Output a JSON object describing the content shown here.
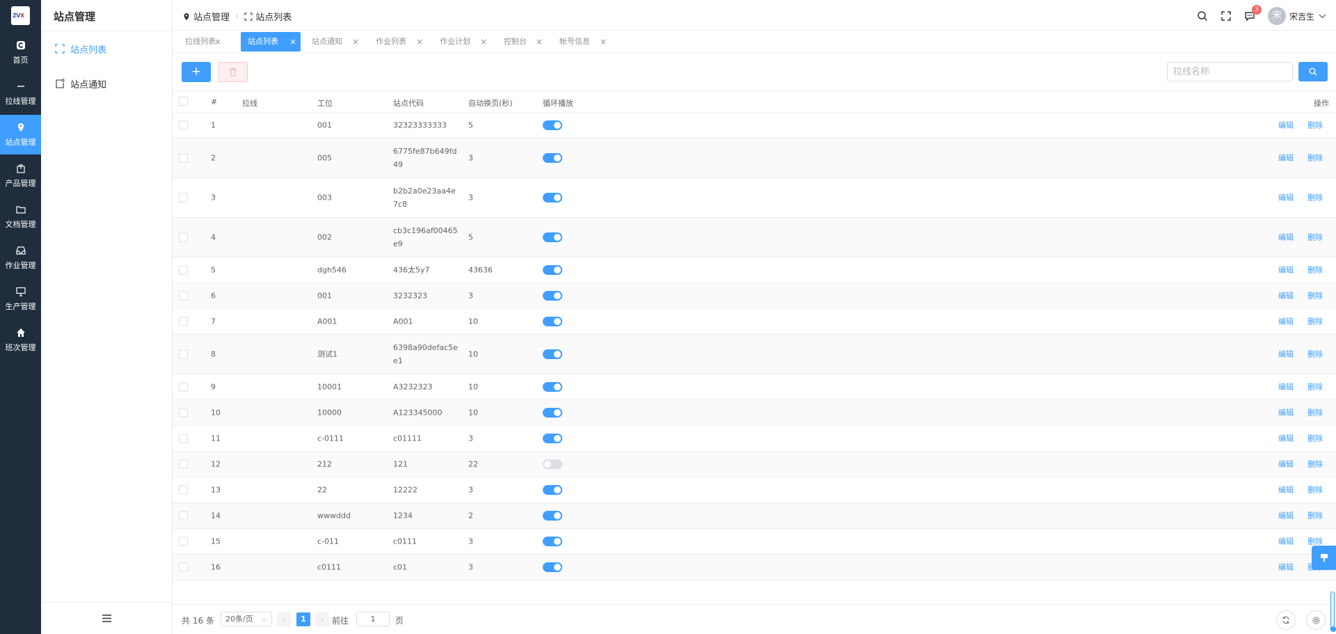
{
  "logo": {
    "text_a": "ZV",
    "text_b": "X"
  },
  "rail": {
    "items": [
      {
        "label": "首页",
        "icon": "home-c-icon"
      },
      {
        "label": "拉线管理",
        "icon": "minus-icon"
      },
      {
        "label": "站点管理",
        "icon": "location-icon"
      },
      {
        "label": "产品管理",
        "icon": "box-icon"
      },
      {
        "label": "文档管理",
        "icon": "folder-icon"
      },
      {
        "label": "作业管理",
        "icon": "inbox-icon"
      },
      {
        "label": "生产管理",
        "icon": "monitor-icon"
      },
      {
        "label": "班次管理",
        "icon": "house-icon"
      }
    ],
    "active_index": 2
  },
  "subside": {
    "title": "站点管理",
    "items": [
      {
        "label": "站点列表",
        "icon": "fullscreen-icon"
      },
      {
        "label": "站点通知",
        "icon": "notice-icon"
      }
    ],
    "active_index": 0
  },
  "header": {
    "breadcrumb": [
      "站点管理",
      "站点列表"
    ],
    "message_count": "3",
    "user_name": "宋吉生",
    "avatar_text": "宋"
  },
  "tabs": [
    {
      "label": "拉线列表"
    },
    {
      "label": "站点列表"
    },
    {
      "label": "站点通知"
    },
    {
      "label": "作业列表"
    },
    {
      "label": "作业计划"
    },
    {
      "label": "控制台"
    },
    {
      "label": "帐号信息"
    }
  ],
  "active_tab": 1,
  "toolbar": {
    "add_symbol": "+",
    "search_placeholder": "拉线名称"
  },
  "table": {
    "columns": [
      "#",
      "拉线",
      "工位",
      "站点代码",
      "自动换页(秒)",
      "循环播放",
      "操作"
    ],
    "actions": {
      "edit": "编辑",
      "delete": "删除"
    },
    "rows": [
      {
        "idx": "1",
        "line": "",
        "station": "001",
        "code": [
          "32323333333"
        ],
        "interval": "5",
        "loop": true
      },
      {
        "idx": "2",
        "line": "",
        "station": "005",
        "code": [
          "6775fe87b649fd",
          "49"
        ],
        "interval": "3",
        "loop": true
      },
      {
        "idx": "3",
        "line": "",
        "station": "003",
        "code": [
          "b2b2a0e23aa4e",
          "7c8"
        ],
        "interval": "3",
        "loop": true
      },
      {
        "idx": "4",
        "line": "",
        "station": "002",
        "code": [
          "cb3c196af00465",
          "e9"
        ],
        "interval": "5",
        "loop": true
      },
      {
        "idx": "5",
        "line": "",
        "station": "dgh546",
        "code": [
          "436太5y7"
        ],
        "interval": "43636",
        "loop": true
      },
      {
        "idx": "6",
        "line": "",
        "station": "001",
        "code": [
          "3232323"
        ],
        "interval": "3",
        "loop": true
      },
      {
        "idx": "7",
        "line": "",
        "station": "A001",
        "code": [
          "A001"
        ],
        "interval": "10",
        "loop": true
      },
      {
        "idx": "8",
        "line": "",
        "station": "测试1",
        "code": [
          "6398a90defac5e",
          "e1"
        ],
        "interval": "10",
        "loop": true
      },
      {
        "idx": "9",
        "line": "",
        "station": "10001",
        "code": [
          "A3232323"
        ],
        "interval": "10",
        "loop": true
      },
      {
        "idx": "10",
        "line": "",
        "station": "10000",
        "code": [
          "A123345000"
        ],
        "interval": "10",
        "loop": true
      },
      {
        "idx": "11",
        "line": "",
        "station": "c-0111",
        "code": [
          "c01111"
        ],
        "interval": "3",
        "loop": true
      },
      {
        "idx": "12",
        "line": "",
        "station": "212",
        "code": [
          "121"
        ],
        "interval": "22",
        "loop": false
      },
      {
        "idx": "13",
        "line": "",
        "station": "22",
        "code": [
          "12222"
        ],
        "interval": "3",
        "loop": true
      },
      {
        "idx": "14",
        "line": "",
        "station": "wwwddd",
        "code": [
          "1234"
        ],
        "interval": "2",
        "loop": true
      },
      {
        "idx": "15",
        "line": "",
        "station": "c-011",
        "code": [
          "c0111"
        ],
        "interval": "3",
        "loop": true
      },
      {
        "idx": "16",
        "line": "",
        "station": "c0111",
        "code": [
          "c01"
        ],
        "interval": "3",
        "loop": true
      }
    ]
  },
  "pagination": {
    "total_text": "共 16 条",
    "page_size": "20条/页",
    "current_page": "1",
    "goto_label": "前往",
    "goto_value": "1",
    "page_suffix": "页"
  },
  "colors": {
    "primary": "#409eff",
    "sidebar_bg": "#1f2d3d",
    "danger_light": "#fef0f0"
  }
}
